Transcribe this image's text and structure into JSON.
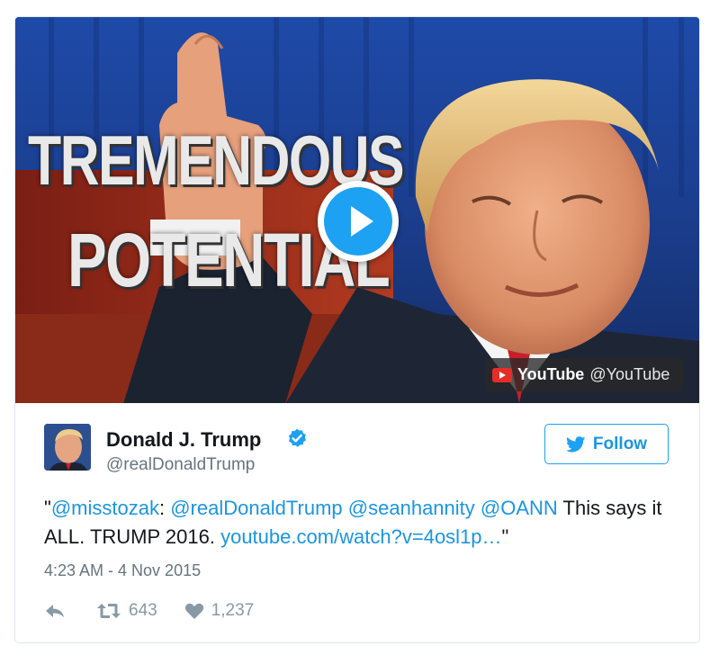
{
  "media": {
    "headline_line1": "TREMENDOUS",
    "headline_line2": "POTENTIAL",
    "youtube_brand": "YouTube",
    "youtube_handle": "@YouTube"
  },
  "author": {
    "name": "Donald J. Trump",
    "handle": "@realDonaldTrump"
  },
  "follow_label": "Follow",
  "tweet": {
    "open_quote": "\"",
    "mention1": "@misstozak",
    "colon": ": ",
    "mention2": "@realDonaldTrump",
    "mention3": "@seanhannity",
    "mention4": "@OANN",
    "text1": " This says it ALL. TRUMP 2016. ",
    "link": "youtube.com/watch?v=4osl1p…",
    "close_quote": "\""
  },
  "timestamp": "4:23 AM - 4 Nov 2015",
  "stats": {
    "retweets": "643",
    "likes": "1,237"
  },
  "colors": {
    "link": "#1b95e0",
    "accent": "#1da1f2",
    "muted": "#66757f",
    "icon": "#8899a6"
  }
}
